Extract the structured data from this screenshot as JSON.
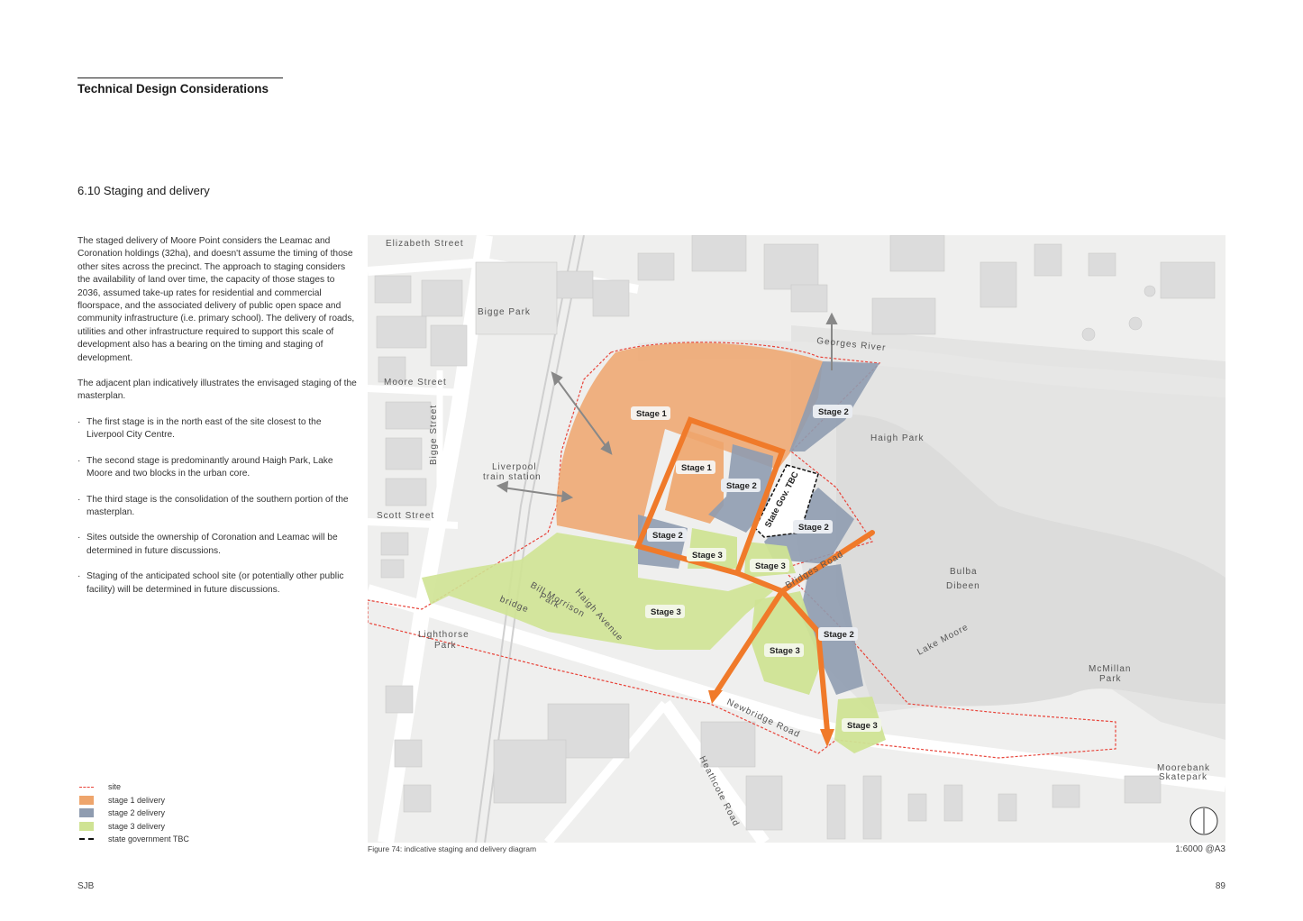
{
  "header": {
    "section_title": "Technical Design Considerations",
    "heading": "6.10  Staging and delivery"
  },
  "body": {
    "intro": "The staged delivery of Moore Point considers the Leamac and Coronation holdings (32ha), and doesn't assume the timing of those other sites across the precinct. The approach to staging considers the availability of land over time, the capacity of those stages to 2036, assumed take-up rates for residential and commercial floorspace, and the associated delivery of public open space and community infrastructure (i.e. primary school). The delivery of roads, utilities and other infrastructure required to support this scale of development also has a bearing on the timing and staging of development.",
    "para2": "The adjacent plan indicatively illustrates the envisaged staging of the masterplan.",
    "bullets": [
      "The first stage is in the north east of the site closest to the Liverpool City Centre.",
      "The second stage is predominantly around Haigh Park, Lake Moore and two blocks in the urban core.",
      "The third stage is the consolidation of the southern portion of the masterplan.",
      "Sites outside the ownership of Coronation and Leamac will be determined in future discussions.",
      "Staging of the anticipated school site (or potentially other public facility) will be determined in future discussions."
    ]
  },
  "legend": {
    "items": [
      {
        "label": "site",
        "color": "#e8443a",
        "kind": "dashed-red"
      },
      {
        "label": "stage 1 delivery",
        "color": "#eea56c",
        "kind": "swatch"
      },
      {
        "label": "stage 2 delivery",
        "color": "#8f9cb0",
        "kind": "swatch"
      },
      {
        "label": "stage 3 delivery",
        "color": "#cfe394",
        "kind": "swatch"
      },
      {
        "label": "state government TBC",
        "color": "#111111",
        "kind": "dashed-black"
      }
    ]
  },
  "map": {
    "places": {
      "elizabeth_street": "Elizabeth Street",
      "bigge_park": "Bigge Park",
      "moore_street": "Moore Street",
      "bigge_street": "Bigge Street",
      "liverpool_train_station_1": "Liverpool",
      "liverpool_train_station_2": "train station",
      "scott_street": "Scott Street",
      "georges_river": "Georges River",
      "haigh_park": "Haigh Park",
      "bulba_dibeen_1": "Bulba",
      "bulba_dibeen_2": "Dibeen",
      "lake_moore": "Lake Moore",
      "mcmillan_park_1": "McMillan",
      "mcmillan_park_2": "Park",
      "moorebank_skatepark_1": "Moorebank",
      "moorebank_skatepark_2": "Skatepark",
      "lighthorse_park_1": "Lighthorse",
      "lighthorse_park_2": "Park",
      "bridge": "bridge",
      "bill_morrison_park_1": "Bill Morrison",
      "bill_morrison_park_2": "Park",
      "haigh_avenue": "Haigh Avenue",
      "bridges_road": "Bridges Road",
      "newbridge_road": "Newbridge Road",
      "heathcote_road": "Heathcote Road"
    },
    "stages": {
      "s1_north": "Stage 1",
      "s1_core": "Stage 1",
      "s2_northeast": "Stage 2",
      "s2_core": "Stage 2",
      "s2_core_south": "Stage 2",
      "s2_haigh": "Stage 2",
      "s2_lake": "Stage 2",
      "s3_west": "Stage 3",
      "s3_core": "Stage 3",
      "s3_small": "Stage 3",
      "s3_south": "Stage 3",
      "s3_east": "Stage 3",
      "state_gov": "State Gov. TBC"
    }
  },
  "caption": "Figure 74: indicative staging and delivery diagram",
  "scale": "1:6000 @A3",
  "footer": {
    "left": "SJB",
    "right": "89"
  }
}
